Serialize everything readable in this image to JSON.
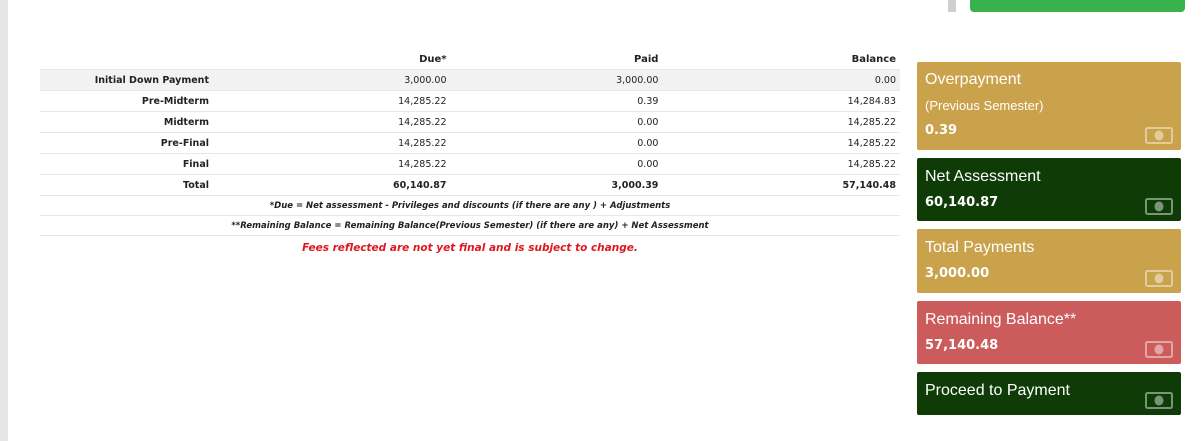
{
  "table": {
    "headers": [
      "",
      "Due*",
      "Paid",
      "Balance"
    ],
    "rows": [
      {
        "label": "Initial Down Payment",
        "due": "3,000.00",
        "paid": "3,000.00",
        "balance": "0.00"
      },
      {
        "label": "Pre-Midterm",
        "due": "14,285.22",
        "paid": "0.39",
        "balance": "14,284.83"
      },
      {
        "label": "Midterm",
        "due": "14,285.22",
        "paid": "0.00",
        "balance": "14,285.22"
      },
      {
        "label": "Pre-Final",
        "due": "14,285.22",
        "paid": "0.00",
        "balance": "14,285.22"
      },
      {
        "label": "Final",
        "due": "14,285.22",
        "paid": "0.00",
        "balance": "14,285.22"
      }
    ],
    "total": {
      "label": "Total",
      "due": "60,140.87",
      "paid": "3,000.39",
      "balance": "57,140.48"
    },
    "note1": "*Due = Net assessment - Privileges and discounts (if there are any ) + Adjustments",
    "note2": "**Remaining Balance = Remaining Balance(Previous Semester) (if there are any) + Net Assessment",
    "disclaimer": "Fees reflected are not yet final and is subject to change."
  },
  "cards": {
    "overpayment": {
      "title": "Overpayment",
      "subtitle": "(Previous Semester)",
      "value": "0.39"
    },
    "net_assessment": {
      "title": "Net Assessment",
      "value": "60,140.87"
    },
    "total_payments": {
      "title": "Total Payments",
      "value": "3,000.00"
    },
    "remaining_balance": {
      "title": "Remaining Balance**",
      "value": "57,140.48"
    },
    "proceed": {
      "title": "Proceed to Payment"
    }
  },
  "icons": {
    "card_icon": "money-bill-icon"
  },
  "colors": {
    "gold": "#c9a24b",
    "dark_green": "#0f3b06",
    "red": "#cc5c5c",
    "disclaimer_red": "#e0171e",
    "top_button_green": "#37b24d"
  }
}
